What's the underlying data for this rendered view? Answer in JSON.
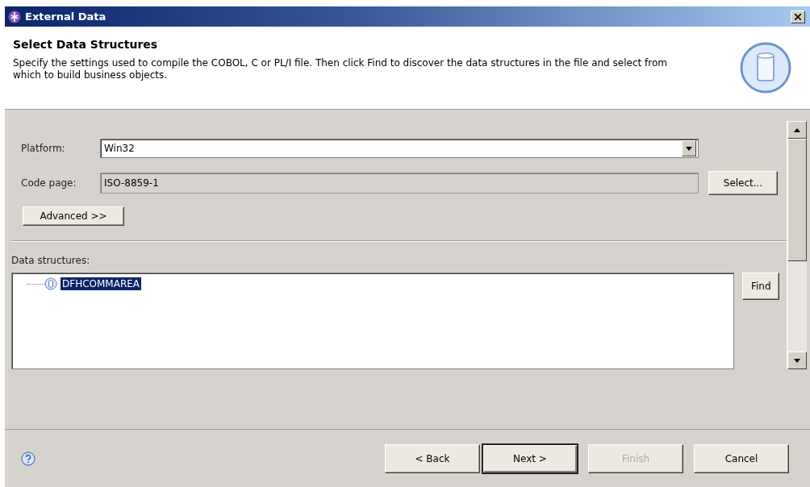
{
  "window": {
    "title": "External Data"
  },
  "header": {
    "title": "Select Data Structures",
    "description": "Specify the settings used to compile the COBOL, C or PL/I file. Then click Find to discover the data structures in the file and select from which to build business objects."
  },
  "form": {
    "platform": {
      "label": "Platform:",
      "value": "Win32"
    },
    "code_page": {
      "label": "Code page:",
      "value": "ISO-8859-1"
    },
    "select_button": "Select...",
    "advanced_button": "Advanced >>"
  },
  "data_structures": {
    "label": "Data structures:",
    "items": [
      {
        "label": "DFHCOMMAREA",
        "selected": true
      }
    ],
    "find_button": "Find"
  },
  "buttons": [
    {
      "label": "< Back",
      "disabled": false,
      "default": false
    },
    {
      "label": "Next >",
      "disabled": false,
      "default": true
    },
    {
      "label": "Finish",
      "disabled": true,
      "default": false
    },
    {
      "label": "Cancel",
      "disabled": false,
      "default": false
    }
  ]
}
